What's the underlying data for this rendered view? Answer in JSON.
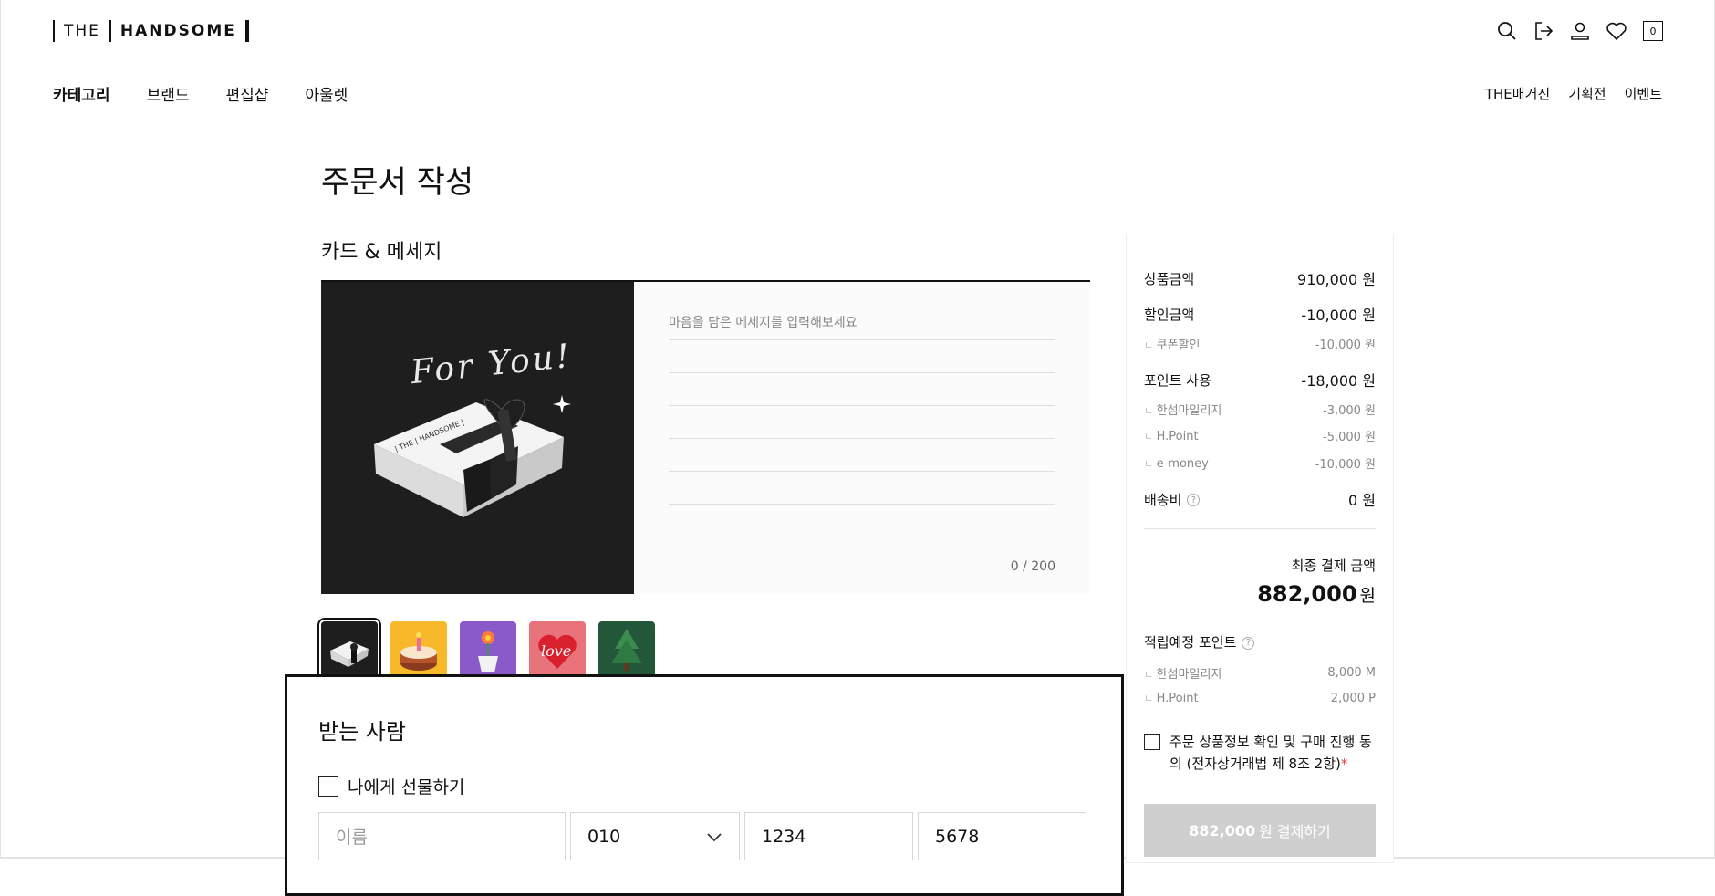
{
  "header": {
    "logo_the": "THE",
    "logo_handsome": "HANDSOME",
    "cart_count": "0",
    "icons": [
      "search-icon",
      "logout-icon",
      "user-icon",
      "heart-icon",
      "cart-icon"
    ]
  },
  "nav": {
    "left": [
      "카테고리",
      "브랜드",
      "편집샵",
      "아울렛"
    ],
    "right": [
      "THE매거진",
      "기획전",
      "이벤트"
    ]
  },
  "page_title": "주문서 작성",
  "card_section": {
    "title": "카드 & 메세지",
    "card_text": "For You!",
    "message_placeholder": "마음을 담은 메세지를 입력해보세요",
    "char_count": "0 / 200",
    "thumbnails": [
      "gift-box",
      "birthday-cake",
      "flower-pot",
      "love-heart",
      "christmas-tree"
    ]
  },
  "recipient": {
    "title": "받는 사람",
    "self_gift_label": "나에게 선물하기",
    "name_placeholder": "이름",
    "phone_prefix": "010",
    "phone_mid": "1234",
    "phone_last": "5678"
  },
  "summary": {
    "product_label": "상품금액",
    "product_value": "910,000 원",
    "discount_label": "할인금액",
    "discount_value": "-10,000 원",
    "coupon_label": "쿠폰할인",
    "coupon_value": "-10,000 원",
    "points_label": "포인트 사용",
    "points_value": "-18,000 원",
    "hansum_label": "한섬마일리지",
    "hansum_value": "-3,000 원",
    "hpoint_label": "H.Point",
    "hpoint_value": "-5,000 원",
    "emoney_label": "e-money",
    "emoney_value": "-10,000 원",
    "shipping_label": "배송비",
    "shipping_value": "0 원",
    "final_label": "최종 결제 금액",
    "final_amount": "882,000",
    "final_unit": "원",
    "earn_label": "적립예정 포인트",
    "earn_hansum_label": "한섬마일리지",
    "earn_hansum_value": "8,000 M",
    "earn_hpoint_label": "H.Point",
    "earn_hpoint_value": "2,000 P",
    "agree_text": "주문 상품정보 확인 및 구매 진행 동의 (전자상거래법 제 8조 2항)",
    "agree_required": "*",
    "pay_amount": "882,000",
    "pay_suffix": "원 결제하기"
  }
}
